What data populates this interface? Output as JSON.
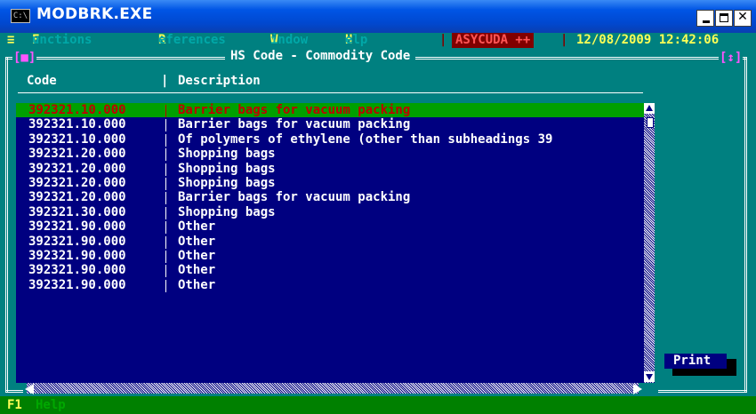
{
  "window": {
    "title": "MODBRK.EXE",
    "icon_text": "C:\\",
    "close_glyph": "✕"
  },
  "menubar": {
    "system": "≡",
    "items": [
      {
        "hotkey": "F",
        "rest": "unctions"
      },
      {
        "hotkey": "R",
        "rest": "eferences"
      },
      {
        "hotkey": "W",
        "rest": "indow"
      },
      {
        "hotkey": "H",
        "rest": "elp"
      }
    ],
    "app_name": "ASYCUDA ++",
    "datetime": "12/08/2009 12:42:06"
  },
  "dialog": {
    "title": "HS Code - Commodity Code",
    "close_marker": "[■]",
    "resize_marker": "[↕]",
    "columns": {
      "code": "Code",
      "description": "Description"
    },
    "rows": [
      {
        "code": "392321.10.000",
        "description": "Barrier bags for vacuum packing",
        "selected": true
      },
      {
        "code": "392321.10.000",
        "description": "Barrier bags for vacuum packing"
      },
      {
        "code": "392321.10.000",
        "description": "Of polymers of ethylene (other than subheadings 39"
      },
      {
        "code": "392321.20.000",
        "description": "Shopping bags"
      },
      {
        "code": "392321.20.000",
        "description": "Shopping bags"
      },
      {
        "code": "392321.20.000",
        "description": "Shopping bags"
      },
      {
        "code": "392321.20.000",
        "description": "Barrier bags for vacuum packing"
      },
      {
        "code": "392321.30.000",
        "description": "Shopping bags"
      },
      {
        "code": "392321.90.000",
        "description": "Other"
      },
      {
        "code": "392321.90.000",
        "description": "Other"
      },
      {
        "code": "392321.90.000",
        "description": "Other"
      },
      {
        "code": "392321.90.000",
        "description": "Other"
      },
      {
        "code": "392321.90.000",
        "description": "Other"
      }
    ],
    "print_label": "Print"
  },
  "statusbar": {
    "key": "F1",
    "label": "Help"
  },
  "colors": {
    "console_bg": "#008080",
    "list_bg": "#000080",
    "selected_bg": "#00a000",
    "selected_text": "#c00000",
    "hotkey": "#ffff55",
    "titlebar": "#0055e5"
  }
}
